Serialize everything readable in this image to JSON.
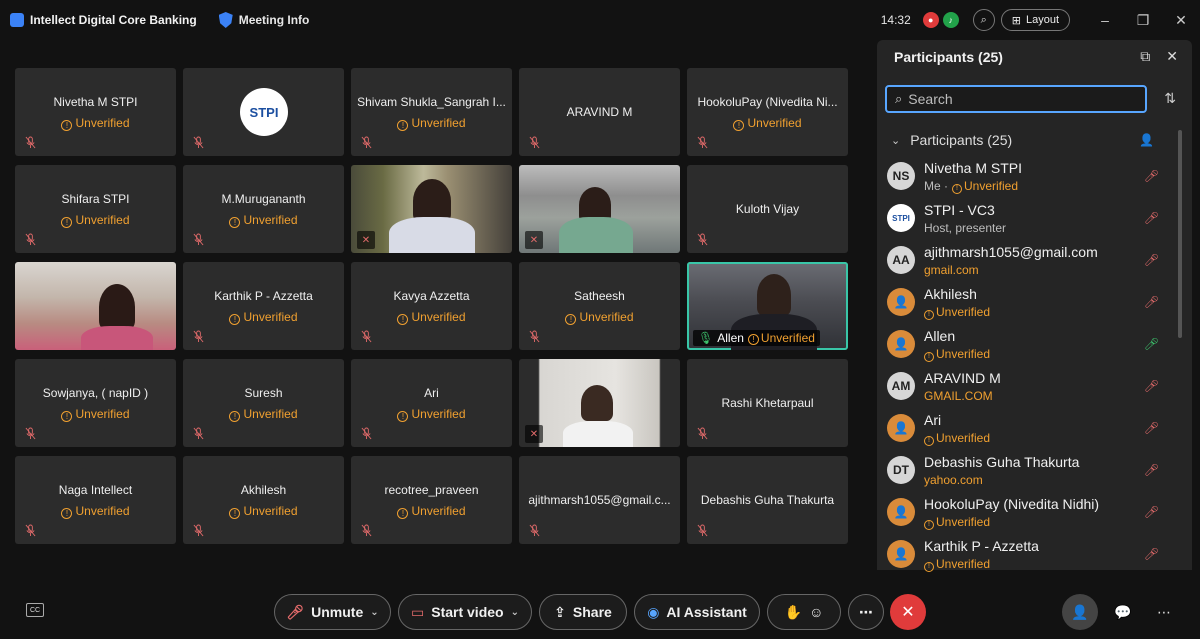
{
  "titlebar": {
    "app_name": "Intellect Digital Core Banking",
    "meeting_info": "Meeting Info",
    "time": "14:32",
    "layout_label": "Layout"
  },
  "unverified": "Unverified",
  "tiles": [
    {
      "name": "Nivetha M STPI",
      "unverified": true
    },
    {
      "name": "",
      "logo": "STPI"
    },
    {
      "name": "Shivam Shukla_Sangrah I...",
      "unverified": true
    },
    {
      "name": "ARAVIND M",
      "unverified": false
    },
    {
      "name": "HookoluPay (Nivedita Ni...",
      "unverified": true
    },
    {
      "name": "Shifara STPI",
      "unverified": true
    },
    {
      "name": "M.Murugananth",
      "unverified": true
    },
    {
      "name": "",
      "video": true
    },
    {
      "name": "",
      "video": true
    },
    {
      "name": "Kuloth Vijay",
      "unverified": false
    },
    {
      "name": "",
      "video": true
    },
    {
      "name": "Karthik P - Azzetta",
      "unverified": true
    },
    {
      "name": "Kavya Azzetta",
      "unverified": true
    },
    {
      "name": "Satheesh",
      "unverified": true
    },
    {
      "name": "Allen",
      "video": true,
      "speaking": true
    },
    {
      "name": "Sowjanya, ( napID )",
      "unverified": true
    },
    {
      "name": "Suresh",
      "unverified": true
    },
    {
      "name": "Ari",
      "unverified": true
    },
    {
      "name": "",
      "video": true
    },
    {
      "name": "Rashi Khetarpaul",
      "unverified": false
    },
    {
      "name": "Naga Intellect",
      "unverified": true
    },
    {
      "name": "Akhilesh",
      "unverified": true
    },
    {
      "name": "recotree_praveen",
      "unverified": true
    },
    {
      "name": "ajithmarsh1055@gmail.c...",
      "unverified": false
    },
    {
      "name": "Debashis Guha Thakurta",
      "unverified": false
    }
  ],
  "panel": {
    "title": "Participants (25)",
    "search_placeholder": "Search",
    "section_label": "Participants (25)",
    "participants": [
      {
        "initials": "NS",
        "name": "Nivetha M STPI",
        "me": "Me ·",
        "sub": "Unverified",
        "type": "gray",
        "sub_style": "warn"
      },
      {
        "initials": "STPI",
        "name": "STPI - VC3",
        "sub": "Host, presenter",
        "type": "logo",
        "sub_style": "plain"
      },
      {
        "initials": "AA",
        "name": "ajithmarsh1055@gmail.com",
        "sub": "gmail.com",
        "type": "gray",
        "sub_style": "warn"
      },
      {
        "initials": "",
        "name": "Akhilesh",
        "sub": "Unverified",
        "type": "orange",
        "sub_style": "warn"
      },
      {
        "initials": "",
        "name": "Allen",
        "sub": "Unverified",
        "type": "orange",
        "sub_style": "warn",
        "mic_on": true
      },
      {
        "initials": "AM",
        "name": "ARAVIND M",
        "sub": "GMAIL.COM",
        "type": "gray",
        "sub_style": "warn"
      },
      {
        "initials": "",
        "name": "Ari",
        "sub": "Unverified",
        "type": "orange",
        "sub_style": "warn"
      },
      {
        "initials": "DT",
        "name": "Debashis Guha Thakurta",
        "sub": "yahoo.com",
        "type": "gray",
        "sub_style": "warn"
      },
      {
        "initials": "",
        "name": "HookoluPay (Nivedita Nidhi)",
        "sub": "Unverified",
        "type": "orange",
        "sub_style": "warn"
      },
      {
        "initials": "",
        "name": "Karthik P - Azzetta",
        "sub": "Unverified",
        "type": "orange",
        "sub_style": "warn"
      }
    ]
  },
  "controls": {
    "unmute": "Unmute",
    "start_video": "Start video",
    "share": "Share",
    "ai_assistant": "AI Assistant",
    "cc": "CC"
  },
  "colors": {
    "accent": "#58a6ff",
    "warning": "#f0a030",
    "muted": "#e36b6b",
    "speaking": "#39c6a8",
    "end_call": "#e03b3b"
  }
}
